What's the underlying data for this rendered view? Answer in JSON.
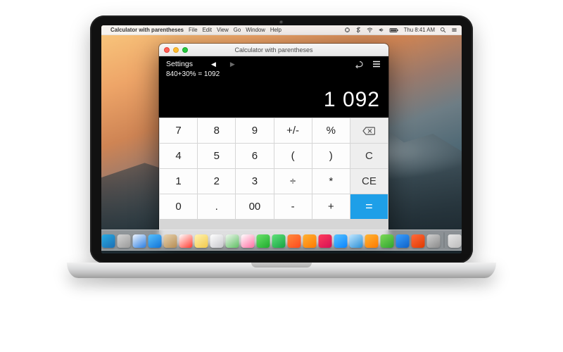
{
  "menubar": {
    "apple": "",
    "app_name": "Calculator with parentheses",
    "menus": [
      "File",
      "Edit",
      "View",
      "Go",
      "Window",
      "Help"
    ],
    "clock": "Thu 8:41 AM",
    "right_icons": [
      "aux-menu-icon",
      "bluetooth-icon",
      "wifi-icon",
      "volume-icon",
      "battery-icon"
    ],
    "search_icon": "search-icon",
    "menu_icon": "menu-icon"
  },
  "window": {
    "title": "Calculator with parentheses",
    "settings_label": "Settings",
    "nav_back": "◀",
    "nav_forward": "▶",
    "undo_icon": "undo-icon",
    "list_icon": "list-icon",
    "history": "840+30% = 1092",
    "result": "1 092"
  },
  "keypad": {
    "rows": [
      [
        {
          "k": "7",
          "t": "num"
        },
        {
          "k": "8",
          "t": "num"
        },
        {
          "k": "9",
          "t": "num"
        },
        {
          "k": "+/-",
          "t": "op"
        },
        {
          "k": "%",
          "t": "op"
        },
        {
          "k": "back",
          "t": "func"
        }
      ],
      [
        {
          "k": "4",
          "t": "num"
        },
        {
          "k": "5",
          "t": "num"
        },
        {
          "k": "6",
          "t": "num"
        },
        {
          "k": "(",
          "t": "op"
        },
        {
          "k": ")",
          "t": "op"
        },
        {
          "k": "C",
          "t": "func"
        }
      ],
      [
        {
          "k": "1",
          "t": "num"
        },
        {
          "k": "2",
          "t": "num"
        },
        {
          "k": "3",
          "t": "num"
        },
        {
          "k": "÷",
          "t": "op"
        },
        {
          "k": "*",
          "t": "op"
        },
        {
          "k": "CE",
          "t": "func"
        }
      ],
      [
        {
          "k": "0",
          "t": "num"
        },
        {
          "k": ".",
          "t": "num"
        },
        {
          "k": "00",
          "t": "num"
        },
        {
          "k": "-",
          "t": "op"
        },
        {
          "k": "+",
          "t": "op"
        },
        {
          "k": "=",
          "t": "equals"
        }
      ]
    ]
  },
  "dock": {
    "apps": [
      {
        "name": "finder",
        "c1": "#29abe2",
        "c2": "#1b6fb5"
      },
      {
        "name": "launchpad",
        "c1": "#d4d4d4",
        "c2": "#9a9a9a"
      },
      {
        "name": "safari",
        "c1": "#f0f6ff",
        "c2": "#2a7de1"
      },
      {
        "name": "mail",
        "c1": "#57c1ff",
        "c2": "#1173d6"
      },
      {
        "name": "contacts",
        "c1": "#e8d3b0",
        "c2": "#b58c53"
      },
      {
        "name": "calendar",
        "c1": "#ffffff",
        "c2": "#ff3b30"
      },
      {
        "name": "notes",
        "c1": "#fff3b0",
        "c2": "#f2c94c"
      },
      {
        "name": "reminders",
        "c1": "#ffffff",
        "c2": "#c7c7cc"
      },
      {
        "name": "maps",
        "c1": "#eef7ee",
        "c2": "#5fbf63"
      },
      {
        "name": "photos",
        "c1": "#ffffff",
        "c2": "#ff6fa3"
      },
      {
        "name": "messages",
        "c1": "#6be26b",
        "c2": "#1fab2d"
      },
      {
        "name": "facetime",
        "c1": "#5fe27a",
        "c2": "#17a344"
      },
      {
        "name": "photobooth",
        "c1": "#ff8a3c",
        "c2": "#ff4a1c"
      },
      {
        "name": "ibooks",
        "c1": "#ffb134",
        "c2": "#ff7a00"
      },
      {
        "name": "itunes",
        "c1": "#ff3b5c",
        "c2": "#d40f55"
      },
      {
        "name": "appstore",
        "c1": "#58c3ff",
        "c2": "#0a84ff"
      },
      {
        "name": "preview",
        "c1": "#bfe6ff",
        "c2": "#2a8fd6"
      },
      {
        "name": "pages",
        "c1": "#ffb534",
        "c2": "#ff7a00"
      },
      {
        "name": "numbers",
        "c1": "#7ed957",
        "c2": "#2fa52f"
      },
      {
        "name": "keynote",
        "c1": "#3aa0ff",
        "c2": "#0f62c9"
      },
      {
        "name": "calculator",
        "c1": "#ff6a3c",
        "c2": "#e03a00"
      },
      {
        "name": "systemprefs",
        "c1": "#d0d0d0",
        "c2": "#8a8a8a"
      }
    ],
    "trash": {
      "name": "trash",
      "c1": "#e6e6e6",
      "c2": "#bcbcbc"
    }
  }
}
